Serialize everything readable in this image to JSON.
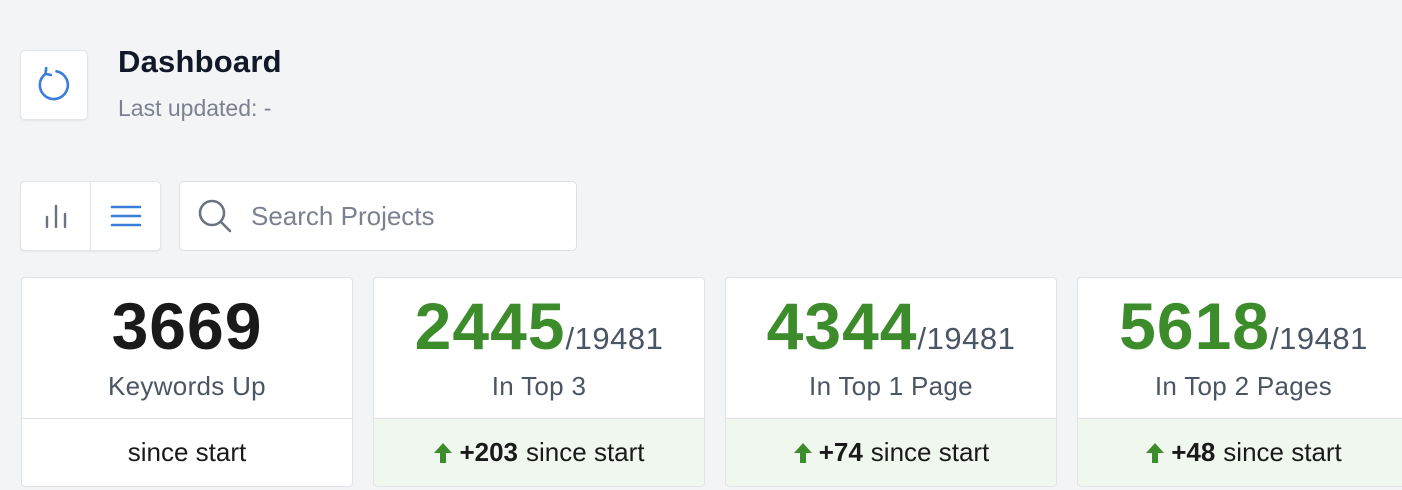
{
  "header": {
    "title": "Dashboard",
    "subtitle": "Last updated: -",
    "refresh_icon": "refresh-icon"
  },
  "toolbar": {
    "view_chart_icon": "bar-chart-icon",
    "view_list_icon": "list-icon",
    "search": {
      "placeholder": "Search Projects",
      "value": ""
    }
  },
  "cards": [
    {
      "value": "3669",
      "total": "",
      "label": "Keywords Up",
      "delta": "",
      "footer": "since start",
      "value_color": "#1a1a1a"
    },
    {
      "value": "2445",
      "total": "/19481",
      "label": "In Top 3",
      "delta": "+203",
      "footer": "since start",
      "value_color": "#3c8c2c"
    },
    {
      "value": "4344",
      "total": "/19481",
      "label": "In Top 1 Page",
      "delta": "+74",
      "footer": "since start",
      "value_color": "#3c8c2c"
    },
    {
      "value": "5618",
      "total": "/19481",
      "label": "In Top 2 Pages",
      "delta": "+48",
      "footer": "since start",
      "value_color": "#3c8c2c"
    }
  ],
  "colors": {
    "accent_blue": "#3b7dd8",
    "positive_green": "#3c8c2c",
    "positive_bg": "#eff7ee",
    "background": "#f3f4f6"
  }
}
